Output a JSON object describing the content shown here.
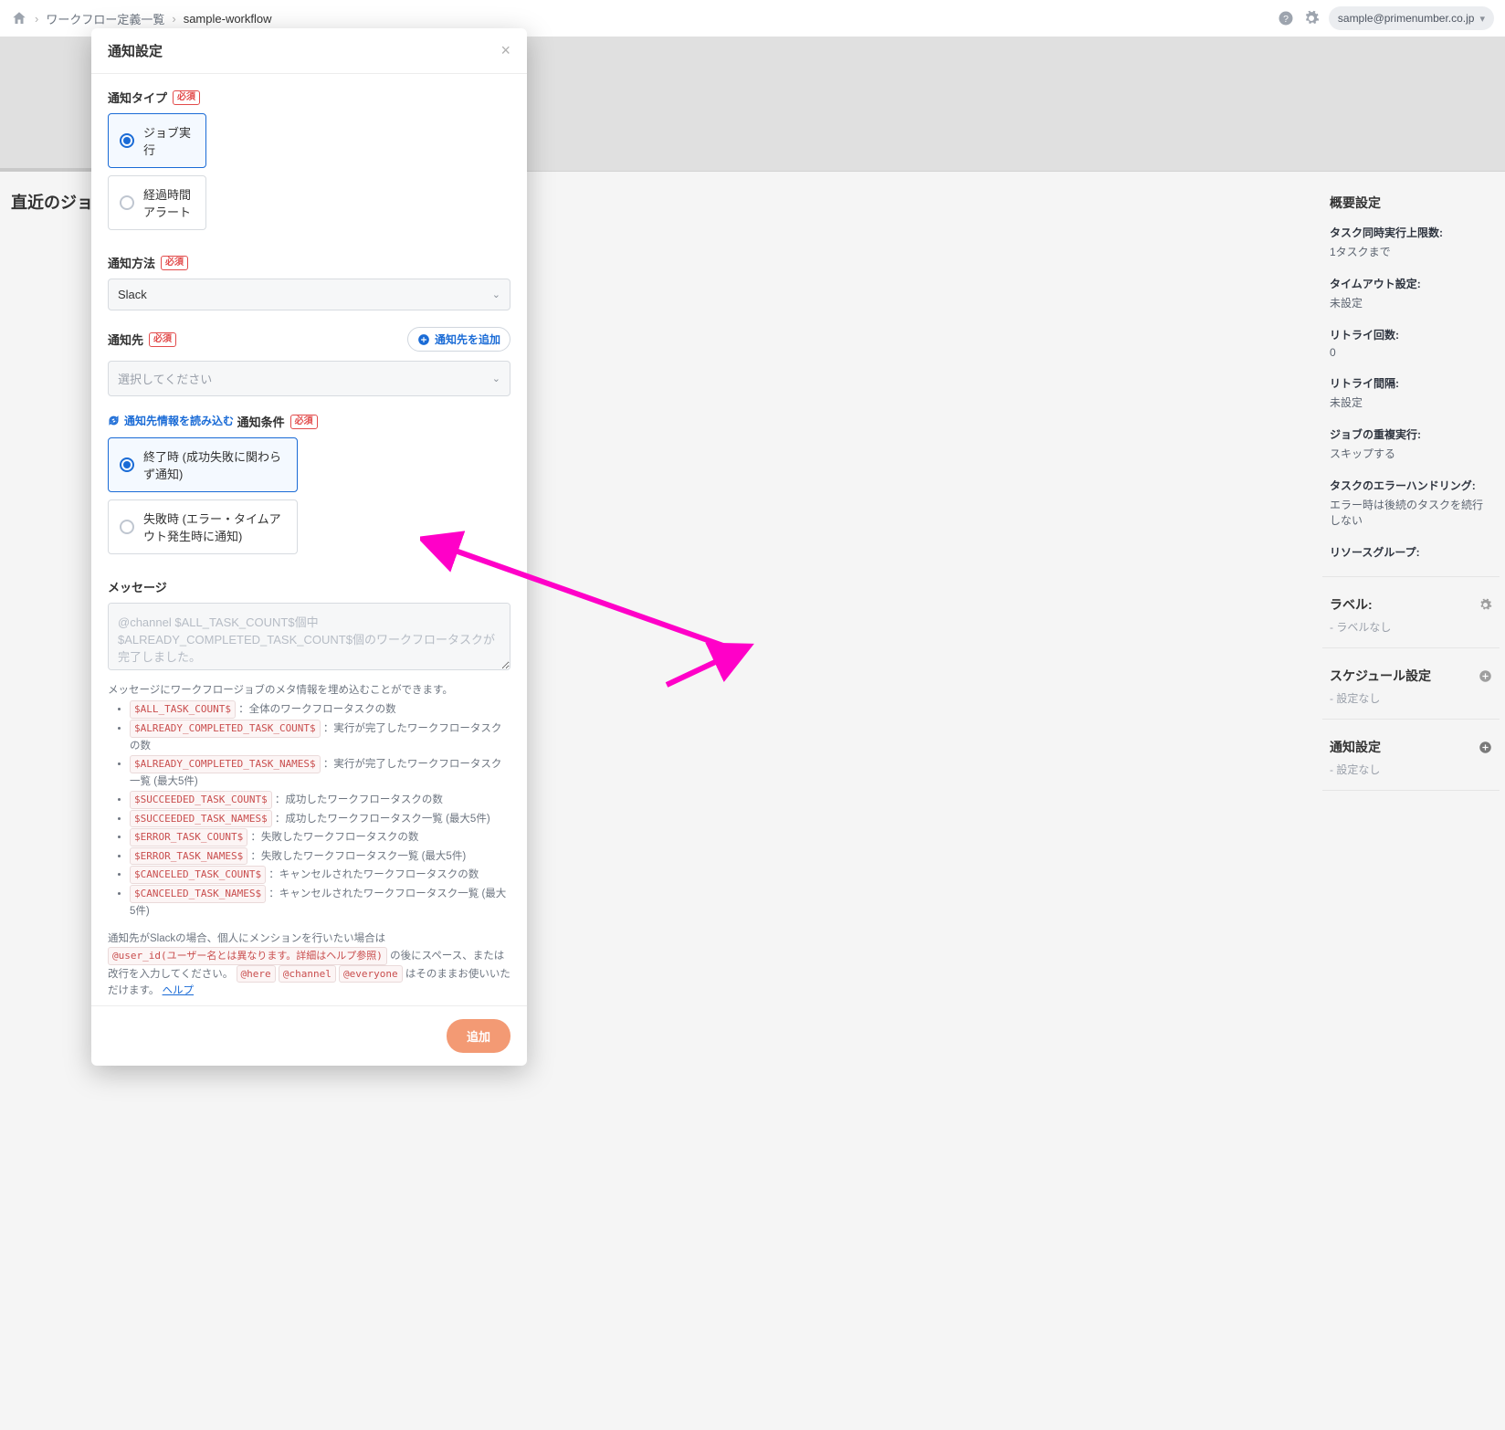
{
  "breadcrumb": {
    "workflow_list": "ワークフロー定義一覧",
    "current": "sample-workflow"
  },
  "user_email": "sample@primenumber.co.jp",
  "left_heading": "直近のジョブ一覧",
  "sidebar": {
    "overview_title": "概要設定",
    "rows": [
      {
        "label": "タスク同時実行上限数:",
        "value": "1タスクまで"
      },
      {
        "label": "タイムアウト設定:",
        "value": "未設定"
      },
      {
        "label": "リトライ回数:",
        "value": "0"
      },
      {
        "label": "リトライ間隔:",
        "value": "未設定"
      },
      {
        "label": "ジョブの重複実行:",
        "value": "スキップする"
      },
      {
        "label": "タスクのエラーハンドリング:",
        "value": "エラー時は後続のタスクを続行しない"
      },
      {
        "label": "リソースグループ:",
        "value": ""
      }
    ],
    "label_section": {
      "title": "ラベル:",
      "value": "- ラベルなし"
    },
    "schedule_section": {
      "title": "スケジュール設定",
      "value": "- 設定なし"
    },
    "notify_section": {
      "title": "通知設定",
      "value": "- 設定なし"
    }
  },
  "modal": {
    "title": "通知設定",
    "required_badge": "必須",
    "type_label": "通知タイプ",
    "type_options": {
      "job": "ジョブ実行",
      "elapsed": "経過時間アラート"
    },
    "method_label": "通知方法",
    "method_value": "Slack",
    "dest_label": "通知先",
    "add_dest": "通知先を追加",
    "dest_placeholder": "選択してください",
    "refresh_dest": "通知先情報を読み込む",
    "cond_label": "通知条件",
    "cond_options": {
      "end": "終了時 (成功失敗に関わらず通知)",
      "fail": "失敗時 (エラー・タイムアウト発生時に通知)"
    },
    "message_label": "メッセージ",
    "message_placeholder": "@channel $ALL_TASK_COUNT$個中$ALREADY_COMPLETED_TASK_COUNT$個のワークフロータスクが完了しました。",
    "help_intro": "メッセージにワークフロージョブのメタ情報を埋め込むことができます。",
    "vars": [
      {
        "code": "$ALL_TASK_COUNT$",
        "desc": "：全体のワークフロータスクの数"
      },
      {
        "code": "$ALREADY_COMPLETED_TASK_COUNT$",
        "desc": "：実行が完了したワークフロータスクの数"
      },
      {
        "code": "$ALREADY_COMPLETED_TASK_NAMES$",
        "desc": "：実行が完了したワークフロータスク一覧 (最大5件)"
      },
      {
        "code": "$SUCCEEDED_TASK_COUNT$",
        "desc": "：成功したワークフロータスクの数"
      },
      {
        "code": "$SUCCEEDED_TASK_NAMES$",
        "desc": "：成功したワークフロータスク一覧 (最大5件)"
      },
      {
        "code": "$ERROR_TASK_COUNT$",
        "desc": "：失敗したワークフロータスクの数"
      },
      {
        "code": "$ERROR_TASK_NAMES$",
        "desc": "：失敗したワークフロータスク一覧 (最大5件)"
      },
      {
        "code": "$CANCELED_TASK_COUNT$",
        "desc": "：キャンセルされたワークフロータスクの数"
      },
      {
        "code": "$CANCELED_TASK_NAMES$",
        "desc": "：キャンセルされたワークフロータスク一覧 (最大5件)"
      }
    ],
    "slack_hint_pre": "通知先がSlackの場合、個人にメンションを行いたい場合は ",
    "slack_user_code": "@user_id(ユーザー名とは異なります。詳細はヘルプ参照)",
    "slack_hint_mid": " の後にスペース、または改行を入力してください。 ",
    "slack_codes": [
      "@here",
      "@channel",
      "@everyone"
    ],
    "slack_hint_end": " はそのままお使いいただけます。",
    "help_link": "ヘルプ",
    "submit": "追加"
  },
  "arrow_color": "#ff00c8"
}
